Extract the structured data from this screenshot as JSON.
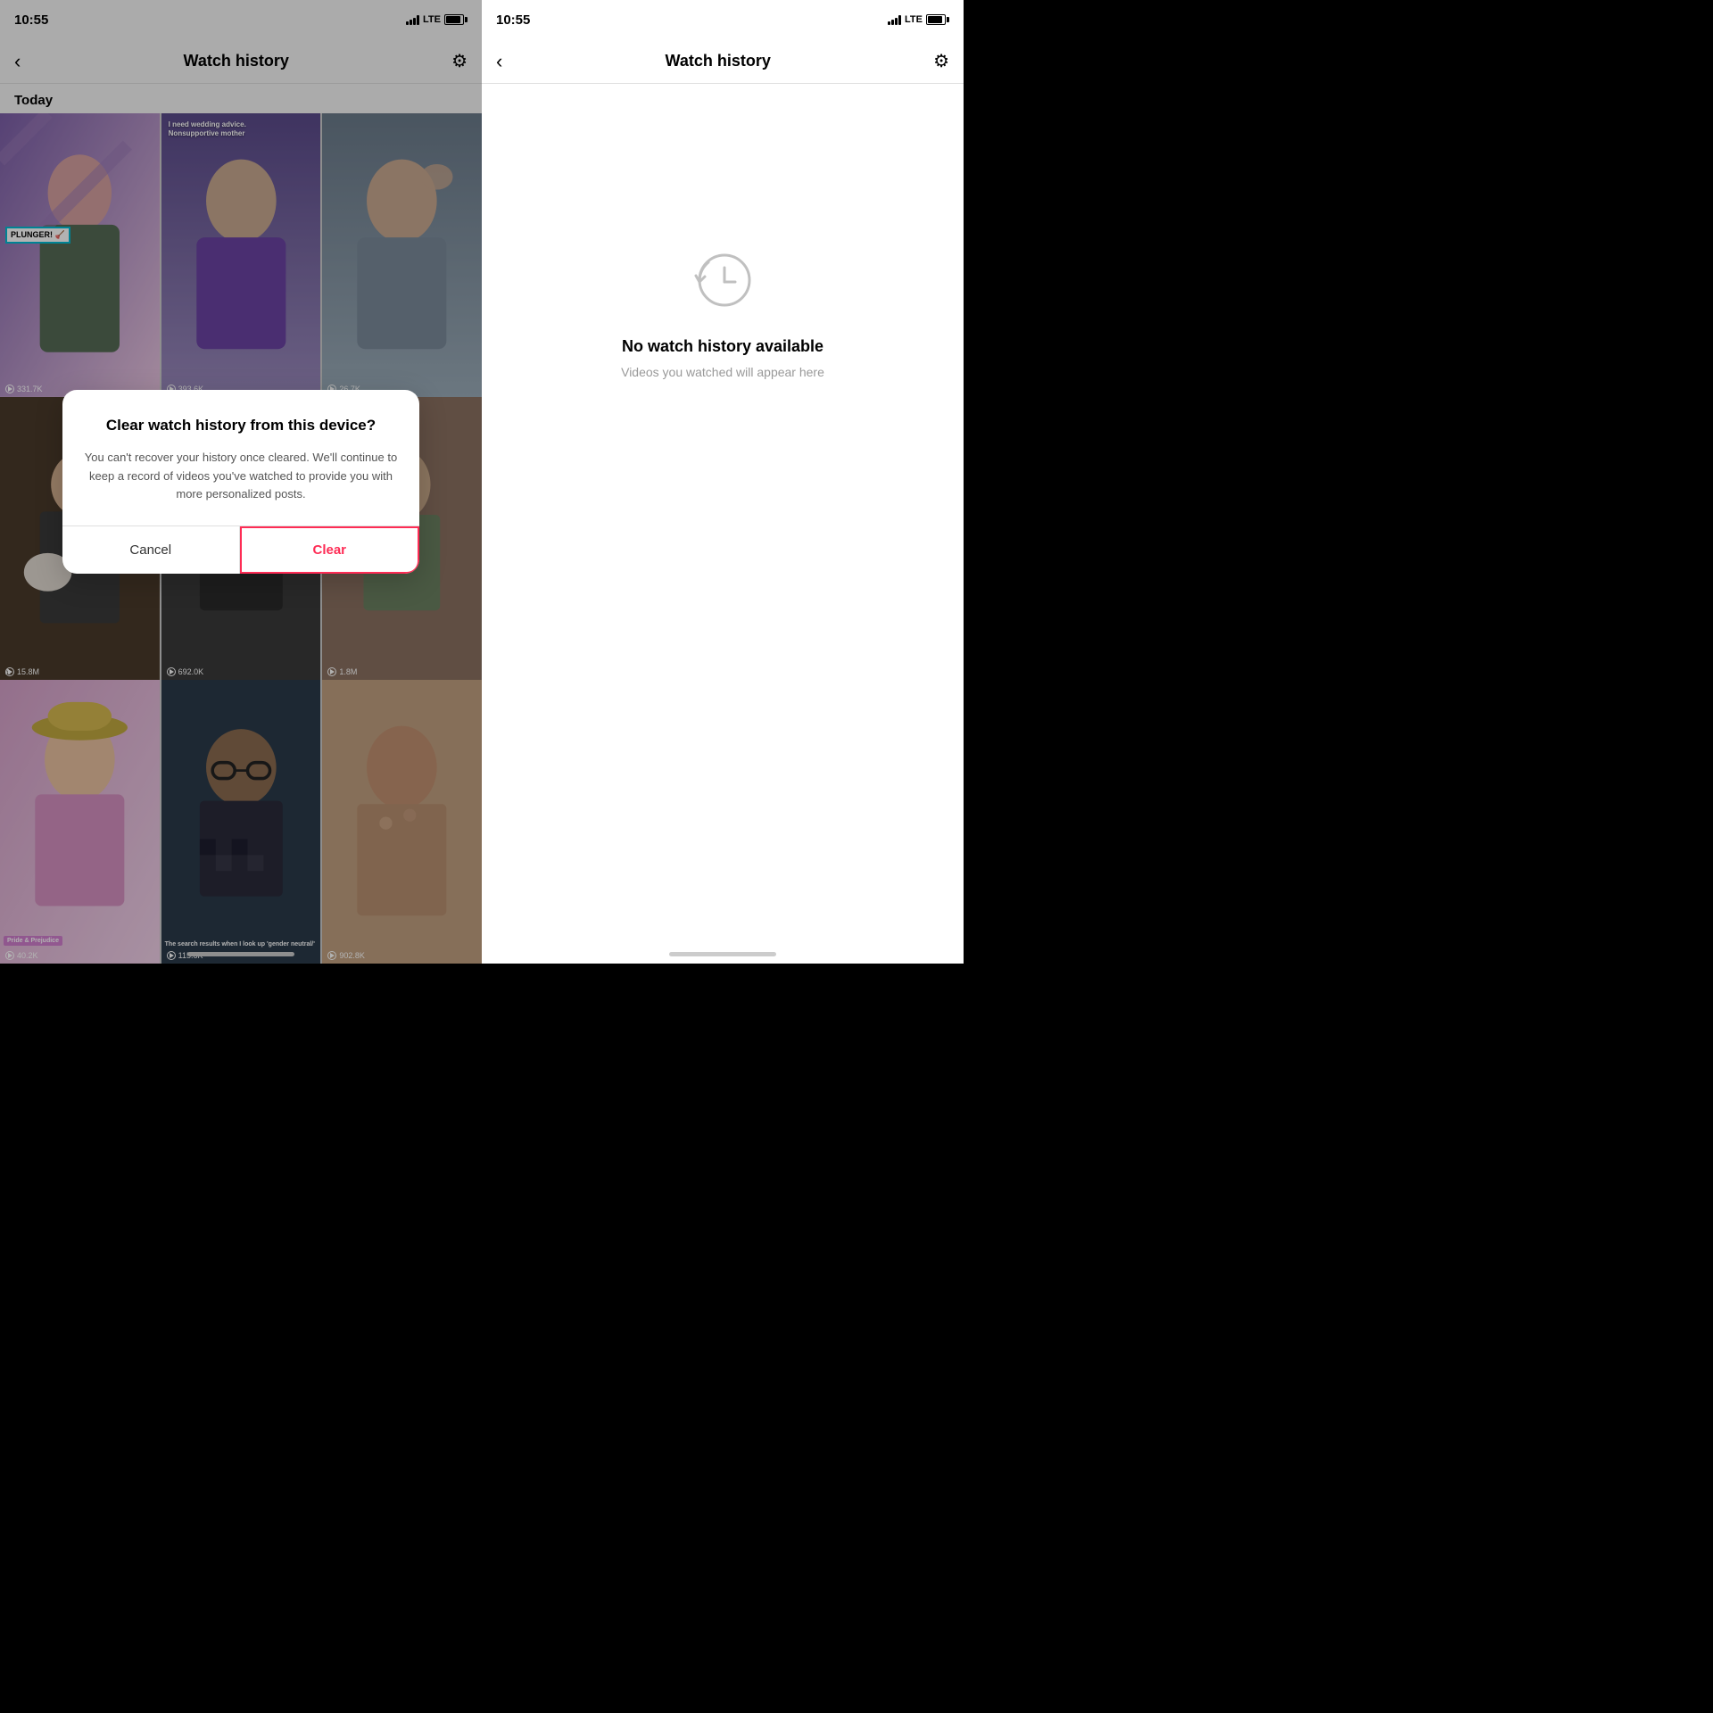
{
  "left": {
    "status_time": "10:55",
    "lte": "LTE",
    "nav_back": "‹",
    "nav_title": "Watch history",
    "section_today": "Today",
    "videos": [
      {
        "id": 1,
        "count": "331.7K",
        "label": "",
        "tag": "PLUNGER! 🪠",
        "thumb_class": "thumb-1"
      },
      {
        "id": 2,
        "count": "393.6K",
        "label": "I need wedding advice.\nNonsupportive mother",
        "thumb_class": "thumb-2"
      },
      {
        "id": 3,
        "count": "26.7K",
        "label": "",
        "thumb_class": "thumb-3"
      },
      {
        "id": 4,
        "count": "15.8M",
        "label": "",
        "thumb_class": "thumb-4"
      },
      {
        "id": 5,
        "count": "692.0K",
        "label": "",
        "thumb_class": "thumb-5"
      },
      {
        "id": 6,
        "count": "1.8M",
        "label": "",
        "thumb_class": "thumb-6"
      },
      {
        "id": 7,
        "count": "40.2K",
        "label": "Pride & Prejudice",
        "thumb_class": "thumb-7"
      },
      {
        "id": 8,
        "count": "115.6K",
        "label": "The search results when I look up 'gender neutral/'",
        "thumb_class": "thumb-8"
      },
      {
        "id": 9,
        "count": "902.8K",
        "label": "",
        "thumb_class": "thumb-9"
      }
    ],
    "dialog": {
      "title": "Clear watch history from this device?",
      "body": "You can't recover your history once cleared. We'll continue to keep a record of videos you've watched to provide you with more personalized posts.",
      "cancel_label": "Cancel",
      "clear_label": "Clear"
    }
  },
  "right": {
    "status_time": "10:55",
    "lte": "LTE",
    "nav_back": "‹",
    "nav_title": "Watch history",
    "empty_title": "No watch history available",
    "empty_subtitle": "Videos you watched will appear here"
  }
}
